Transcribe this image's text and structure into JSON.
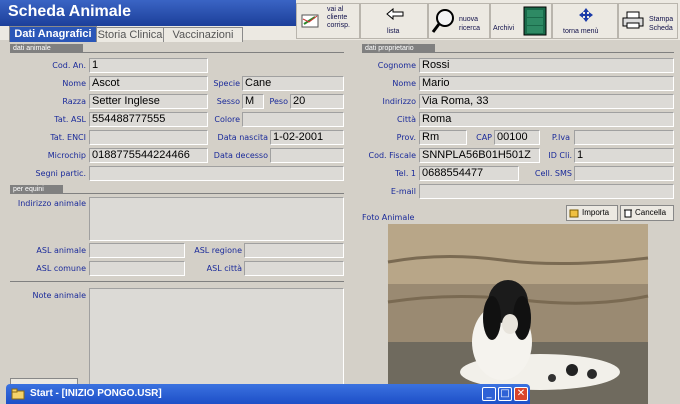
{
  "app": {
    "title": "Scheda Animale"
  },
  "tabs": [
    {
      "label": "Dati Anagrafici",
      "active": true
    },
    {
      "label": "Storia Clinica",
      "active": false
    },
    {
      "label": "Vaccinazioni",
      "active": false
    }
  ],
  "toolbar": {
    "send": {
      "line1": "vai al",
      "line2": "cliente",
      "line3": "corrisp.",
      "icon": "send-mail-icon"
    },
    "lista": {
      "label": "lista",
      "icon": "back-arrow-icon"
    },
    "nuova": {
      "line1": "nuova",
      "line2": "ricerca",
      "icon": "magnifier-icon"
    },
    "archivi": {
      "label": "Archivi",
      "icon": "archive-cabinet-icon"
    },
    "menu": {
      "label": "torna menù",
      "icon": "move-cross-icon"
    },
    "stampa": {
      "line1": "Stampa",
      "line2": "Scheda",
      "icon": "printer-icon"
    }
  },
  "animal": {
    "section": "dati animale",
    "cod_label": "Cod. An.",
    "cod": "1",
    "nome_label": "Nome",
    "nome": "Ascot",
    "specie_label": "Specie",
    "specie": "Cane",
    "razza_label": "Razza",
    "razza": "Setter Inglese",
    "sesso_label": "Sesso",
    "sesso": "M",
    "peso_label": "Peso",
    "peso": "20",
    "asl_label": "Tat. ASL",
    "asl": "554488777555",
    "colore_label": "Colore",
    "colore": "",
    "enci_label": "Tat. ENCI",
    "enci": "",
    "nascita_label": "Data nascita",
    "nascita": "1-02-2001",
    "microchip_label": "Microchip",
    "microchip": "0188775544224466",
    "decesso_label": "Data decesso",
    "decesso": "",
    "segni_label": "Segni partic.",
    "segni": ""
  },
  "equini": {
    "section": "per equini",
    "indirizzo_label": "Indirizzo animale",
    "asl_animale_label": "ASL animale",
    "asl_regione_label": "ASL regione",
    "asl_comune_label": "ASL comune",
    "asl_citta_label": "ASL città",
    "note_label": "Note animale"
  },
  "owner": {
    "section": "dati proprietario",
    "cognome_label": "Cognome",
    "cognome": "Rossi",
    "nome_label": "Nome",
    "nome": "Mario",
    "indirizzo_label": "Indirizzo",
    "indirizzo": "Via Roma, 33",
    "citta_label": "Città",
    "citta": "Roma",
    "prov_label": "Prov.",
    "prov": "Rm",
    "cap_label": "CAP",
    "cap": "00100",
    "piva_label": "P.Iva",
    "piva": "",
    "cf_label": "Cod. Fiscale",
    "cf": "SNNPLA56B01H501Z",
    "idcli_label": "ID Cli.",
    "idcli": "1",
    "tel_label": "Tel. 1",
    "tel": "0688554477",
    "sms_label": "Cell. SMS",
    "sms": "",
    "email_label": "E-mail",
    "email": ""
  },
  "photo": {
    "label": "Foto Animale",
    "importa": "Importa",
    "cancella": "Cancella"
  },
  "taskbar": {
    "title": "Start - [INIZIO PONGO.USR]"
  }
}
